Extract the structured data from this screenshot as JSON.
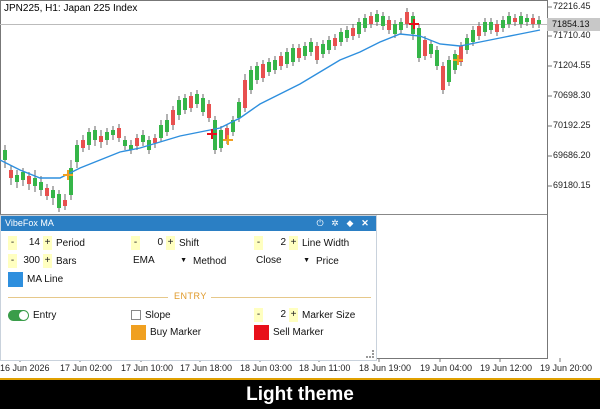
{
  "chart": {
    "symbol_title": "JPN225, H1:  Japan 225 Index",
    "current_price": "71854.13",
    "price_levels": [
      "72216.45",
      "71710.40",
      "71204.55",
      "70698.30",
      "70192.25",
      "69686.20",
      "69180.15"
    ],
    "time_labels": [
      "16 Jun 2026",
      "17 Jun 02:00",
      "17 Jun 10:00",
      "17 Jun 18:00",
      "18 Jun 03:00",
      "18 Jun 11:00",
      "18 Jun 19:00",
      "19 Jun 04:00",
      "19 Jun 12:00",
      "19 Jun 20:00"
    ],
    "colors": {
      "bull": "#35b548",
      "bear": "#e8504f",
      "ma": "#2e8fde",
      "buy_marker": "#f0a020",
      "sell_marker": "#e8101a"
    }
  },
  "panel": {
    "title": "VibeFox MA",
    "header_icons": [
      "power-icon",
      "gear-icon",
      "pin-icon",
      "close-icon"
    ],
    "period": {
      "value": "14",
      "label": "Period"
    },
    "shift": {
      "value": "0",
      "label": "Shift"
    },
    "line_width": {
      "value": "2",
      "label": "Line Width"
    },
    "bars": {
      "value": "300",
      "label": "Bars"
    },
    "method": {
      "value": "EMA",
      "label": "Method"
    },
    "price": {
      "value": "Close",
      "label": "Price"
    },
    "ma_line": {
      "label": "MA Line",
      "color": "#2e8fde"
    },
    "entry_section": "ENTRY",
    "entry": {
      "label": "Entry",
      "enabled": true
    },
    "slope": {
      "label": "Slope",
      "checked": false
    },
    "marker_size": {
      "value": "2",
      "label": "Marker Size"
    },
    "buy_marker": {
      "label": "Buy Marker",
      "color": "#f0a020"
    },
    "sell_marker": {
      "label": "Sell Marker",
      "color": "#e8101a"
    },
    "minus": "-",
    "plus": "+"
  },
  "banner": {
    "text": "Light theme"
  }
}
